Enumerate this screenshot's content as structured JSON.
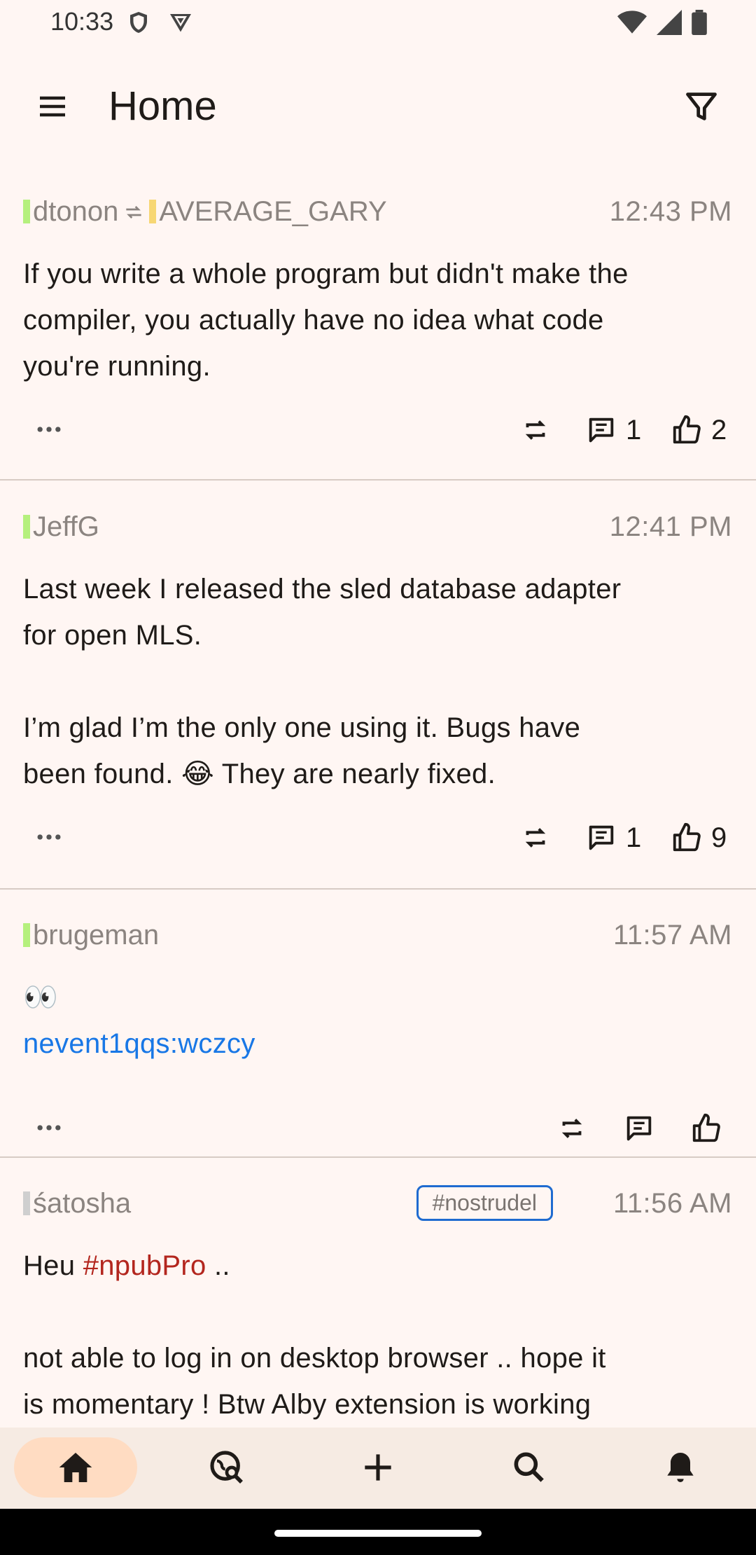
{
  "status_bar": {
    "time": "10:33"
  },
  "app_bar": {
    "title": "Home"
  },
  "posts": [
    {
      "author": "dtonon",
      "reposted_author": "AVERAGE_GARY",
      "time": "12:43 PM",
      "content_lines": [
        "If you write a whole program but didn't make the",
        "compiler, you actually have no idea what code",
        "you're running."
      ],
      "replies": "1",
      "likes": "2"
    },
    {
      "author": "JeffG",
      "time": "12:41 PM",
      "content_lines": [
        "Last week I released the sled database adapter",
        "for open MLS.",
        "",
        "I’m glad I’m the only one using it. Bugs have",
        "been found. 😂 They are nearly fixed."
      ],
      "replies": "1",
      "likes": "9"
    },
    {
      "author": "brugeman",
      "time": "11:57 AM",
      "emoji": "👀",
      "link": "nevent1qqs:wczcy"
    },
    {
      "author": "śatosha",
      "time": "11:56 AM",
      "chip": "#nostrudel",
      "line1_prefix": "Heu ",
      "line1_tag": "#npubPro",
      "line1_suffix": " ..",
      "content_lines": [
        "not able to log in on desktop browser  .. hope it",
        "is momentary !  Btw Alby extension is working"
      ]
    }
  ],
  "colors": {
    "background": "#fff6f3",
    "accent_nav": "#ffdcc2",
    "link": "#1877e6",
    "hashtag": "#b3261e",
    "author_bar_green": "#b5f07d",
    "author_bar_yellow": "#f7d774",
    "author_bar_grey": "#cfcfcf"
  },
  "bottom_nav": {
    "items": [
      "home-icon",
      "explore-icon",
      "add-icon",
      "search-icon",
      "notifications-icon"
    ],
    "active": "home-icon"
  }
}
